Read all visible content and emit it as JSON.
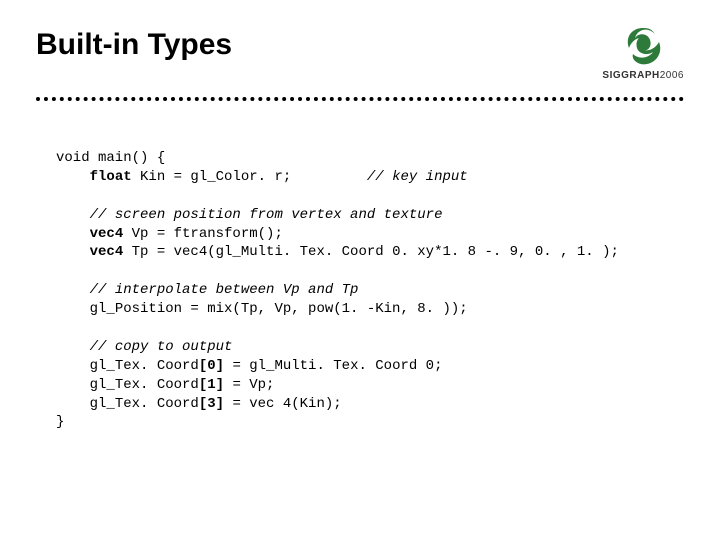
{
  "slide": {
    "title": "Built-in Types"
  },
  "logo": {
    "brand": "SIGGRAPH",
    "year": "2006"
  },
  "code": {
    "l01a": "void main() {",
    "l02kw": "float",
    "l02b": " Kin = gl_Color. r;         ",
    "l02c": "// key input",
    "l03": "",
    "l04c": "// screen position from vertex and texture",
    "l05kw": "vec4",
    "l05b": " Vp = ftransform();",
    "l06kw": "vec4",
    "l06b": " Tp = vec4(gl_Multi. Tex. Coord 0. xy*1. 8 -. 9, 0. , 1. );",
    "l07": "",
    "l08c": "// interpolate between Vp and Tp",
    "l09a": "gl_Position = mix(Tp, Vp, pow(1. -Kin, 8. ));",
    "l10": "",
    "l11c": "// copy to output",
    "l12a": "gl_Tex. Coord",
    "l12kw": "[0]",
    "l12b": " = gl_Multi. Tex. Coord 0;",
    "l13a": "gl_Tex. Coord",
    "l13kw": "[1]",
    "l13b": " = Vp;",
    "l14a": "gl_Tex. Coord",
    "l14kw": "[3]",
    "l14b": " = vec 4(Kin);",
    "l15a": "}"
  }
}
